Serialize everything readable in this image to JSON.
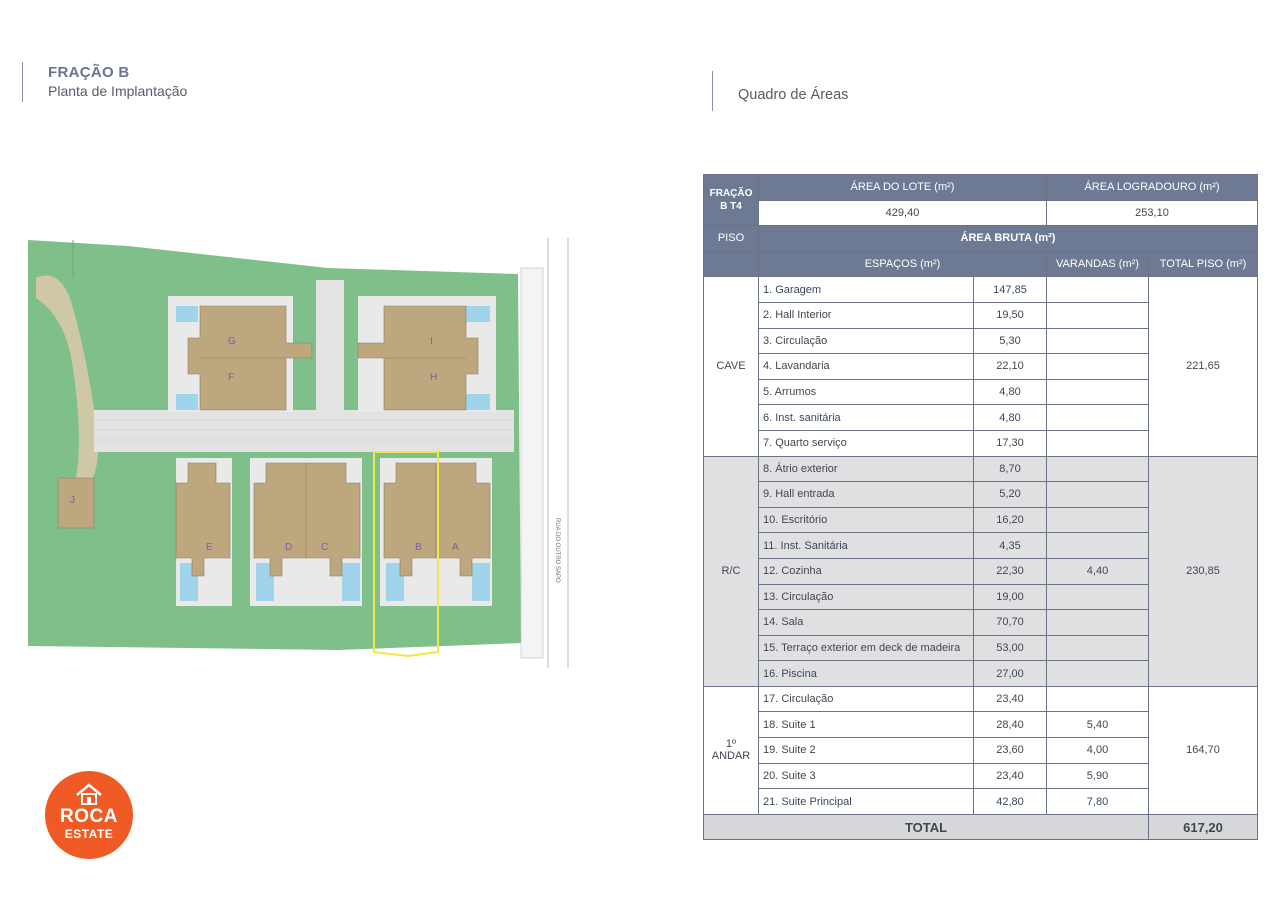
{
  "left_header": {
    "title": "FRAÇÃO B",
    "subtitle": "Planta de Implantação"
  },
  "right_header": {
    "title": "Quadro de Áreas"
  },
  "site_plan": {
    "lot_labels": [
      "G",
      "I",
      "F",
      "H",
      "E",
      "D",
      "C",
      "B",
      "A",
      "J"
    ],
    "street_label": "RUA DO OUTRO SAPO"
  },
  "logo": {
    "line1": "ROCA",
    "line2": "ESTATE"
  },
  "table": {
    "fraction_label": "FRAÇÃO B T4",
    "lot_area_header": "ÁREA DO LOTE (m²)",
    "lot_area_value": "429,40",
    "yard_area_header": "ÁREA LOGRADOURO (m²)",
    "yard_area_value": "253,10",
    "floor_header": "PISO",
    "gross_area_header": "ÁREA BRUTA (m²)",
    "spaces_header": "ESPAÇOS (m²)",
    "verandas_header": "VARANDAS (m²)",
    "total_floor_header": "TOTAL PISO (m²)",
    "floors": [
      {
        "name": "CAVE",
        "total": "221,65",
        "rows": [
          {
            "space": "1. Garagem",
            "area": "147,85",
            "veranda": ""
          },
          {
            "space": "2. Hall Interior",
            "area": "19,50",
            "veranda": ""
          },
          {
            "space": "3. Circulação",
            "area": "5,30",
            "veranda": ""
          },
          {
            "space": "4. Lavandaria",
            "area": "22,10",
            "veranda": ""
          },
          {
            "space": "5. Arrumos",
            "area": "4,80",
            "veranda": ""
          },
          {
            "space": "6. Inst. sanitária",
            "area": "4,80",
            "veranda": ""
          },
          {
            "space": "7. Quarto serviço",
            "area": "17,30",
            "veranda": ""
          }
        ]
      },
      {
        "name": "R/C",
        "total": "230,85",
        "veranda_total": "4,40",
        "rows": [
          {
            "space": "8. Átrio exterior",
            "area": "8,70"
          },
          {
            "space": "9. Hall entrada",
            "area": "5,20"
          },
          {
            "space": "10. Escritório",
            "area": "16,20"
          },
          {
            "space": "11. Inst. Sanitária",
            "area": "4,35"
          },
          {
            "space": "12. Cozinha",
            "area": "22,30"
          },
          {
            "space": "13. Circulação",
            "area": "19,00"
          },
          {
            "space": "14. Sala",
            "area": "70,70"
          },
          {
            "space": "15. Terraço exterior em deck de madeira",
            "area": "53,00"
          },
          {
            "space": "16. Piscina",
            "area": "27,00"
          }
        ]
      },
      {
        "name": "1º ANDAR",
        "total": "164,70",
        "rows": [
          {
            "space": "17. Circulação",
            "area": "23,40",
            "veranda": ""
          },
          {
            "space": "18. Suite 1",
            "area": "28,40",
            "veranda": "5,40"
          },
          {
            "space": "19. Suite 2",
            "area": "23,60",
            "veranda": "4,00"
          },
          {
            "space": "20. Suite 3",
            "area": "23,40",
            "veranda": "5,90"
          },
          {
            "space": "21. Suite Principal",
            "area": "42,80",
            "veranda": "7,80"
          }
        ]
      }
    ],
    "total_label": "TOTAL",
    "total_value": "617,20"
  }
}
